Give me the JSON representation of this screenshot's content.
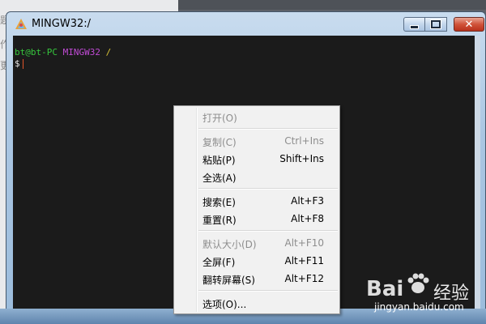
{
  "background": {
    "text_lines": [
      "题",
      "作",
      "更"
    ]
  },
  "window": {
    "title": "MINGW32:/",
    "icon": "mingw-icon",
    "controls": {
      "minimize": "minimize-icon",
      "maximize": "maximize-icon",
      "close": "close-icon",
      "close_glyph": "✕"
    }
  },
  "terminal": {
    "prompt_user": "bt@bt-PC",
    "prompt_env": "MINGW32",
    "prompt_path": "/",
    "prompt_symbol": "$"
  },
  "context_menu": {
    "items": [
      {
        "label": "打开(O)",
        "shortcut": "",
        "disabled": true
      },
      {
        "label": "复制(C)",
        "shortcut": "Ctrl+Ins",
        "disabled": true
      },
      {
        "label": "粘贴(P)",
        "shortcut": "Shift+Ins",
        "disabled": false
      },
      {
        "label": "全选(A)",
        "shortcut": "",
        "disabled": false
      },
      {
        "label": "搜索(E)",
        "shortcut": "Alt+F3",
        "disabled": false
      },
      {
        "label": "重置(R)",
        "shortcut": "Alt+F8",
        "disabled": false
      },
      {
        "label": "默认大小(D)",
        "shortcut": "Alt+F10",
        "disabled": true
      },
      {
        "label": "全屏(F)",
        "shortcut": "Alt+F11",
        "disabled": false
      },
      {
        "label": "翻转屏幕(S)",
        "shortcut": "Alt+F12",
        "disabled": false
      },
      {
        "label": "选项(O)...",
        "shortcut": "",
        "disabled": false
      }
    ]
  },
  "watermark": {
    "brand": "Bai",
    "brand_suffix": "经验",
    "url": "jingyan.baidu.com"
  },
  "colors": {
    "prompt_user": "#36c63d",
    "prompt_env": "#c14bd6",
    "prompt_path": "#d8c337",
    "terminal_bg": "#1b1b1b"
  }
}
